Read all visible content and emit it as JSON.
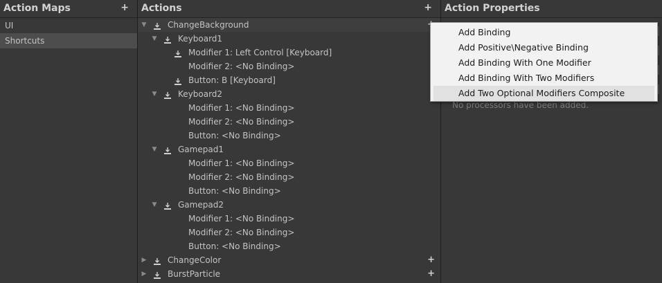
{
  "panels": {
    "action_maps": {
      "title": "Action Maps",
      "add_symbol": "+"
    },
    "actions": {
      "title": "Actions",
      "add_symbol": "+"
    },
    "properties": {
      "title": "Action Properties",
      "hint": "No processors have been added."
    }
  },
  "action_maps": [
    {
      "label": "UI",
      "selected": false
    },
    {
      "label": "Shortcuts",
      "selected": true
    }
  ],
  "actions_tree": [
    {
      "label": "ChangeBackground",
      "level": 0,
      "foldout": "▼",
      "add": "+",
      "selected": true
    },
    {
      "label": "Keyboard1",
      "level": 1,
      "foldout": "▼"
    },
    {
      "label": "Modifier 1: Left Control [Keyboard]",
      "level": 2,
      "icon": true
    },
    {
      "label": "Modifier 2: <No Binding>",
      "level": 2,
      "icon": false
    },
    {
      "label": "Button: B [Keyboard]",
      "level": 2,
      "icon": true
    },
    {
      "label": "Keyboard2",
      "level": 1,
      "foldout": "▼"
    },
    {
      "label": "Modifier 1: <No Binding>",
      "level": 2,
      "icon": false
    },
    {
      "label": "Modifier 2: <No Binding>",
      "level": 2,
      "icon": false
    },
    {
      "label": "Button: <No Binding>",
      "level": 2,
      "icon": false
    },
    {
      "label": "Gamepad1",
      "level": 1,
      "foldout": "▼"
    },
    {
      "label": "Modifier 1: <No Binding>",
      "level": 2,
      "icon": false
    },
    {
      "label": "Modifier 2: <No Binding>",
      "level": 2,
      "icon": false
    },
    {
      "label": "Button: <No Binding>",
      "level": 2,
      "icon": false
    },
    {
      "label": "Gamepad2",
      "level": 1,
      "foldout": "▼"
    },
    {
      "label": "Modifier 1: <No Binding>",
      "level": 2,
      "icon": false
    },
    {
      "label": "Modifier 2: <No Binding>",
      "level": 2,
      "icon": false
    },
    {
      "label": "Button: <No Binding>",
      "level": 2,
      "icon": false
    },
    {
      "label": "ChangeColor",
      "level": 0,
      "foldout": "▶",
      "add": "+"
    },
    {
      "label": "BurstParticle",
      "level": 0,
      "foldout": "▶",
      "add": "+"
    }
  ],
  "context_menu": {
    "items": [
      {
        "label": "Add Binding",
        "hover": false
      },
      {
        "label": "Add Positive\\Negative Binding",
        "hover": false
      },
      {
        "label": "Add Binding With One Modifier",
        "hover": false
      },
      {
        "label": "Add Binding With Two Modifiers",
        "hover": false
      },
      {
        "label": "Add Two Optional Modifiers Composite",
        "hover": true
      }
    ]
  },
  "colors": {
    "background": "#383838",
    "selected_row": "#4d4d4d",
    "text": "#c4c4c4",
    "menu_bg": "#f2f2f2",
    "menu_hover": "#e1e1e1"
  }
}
